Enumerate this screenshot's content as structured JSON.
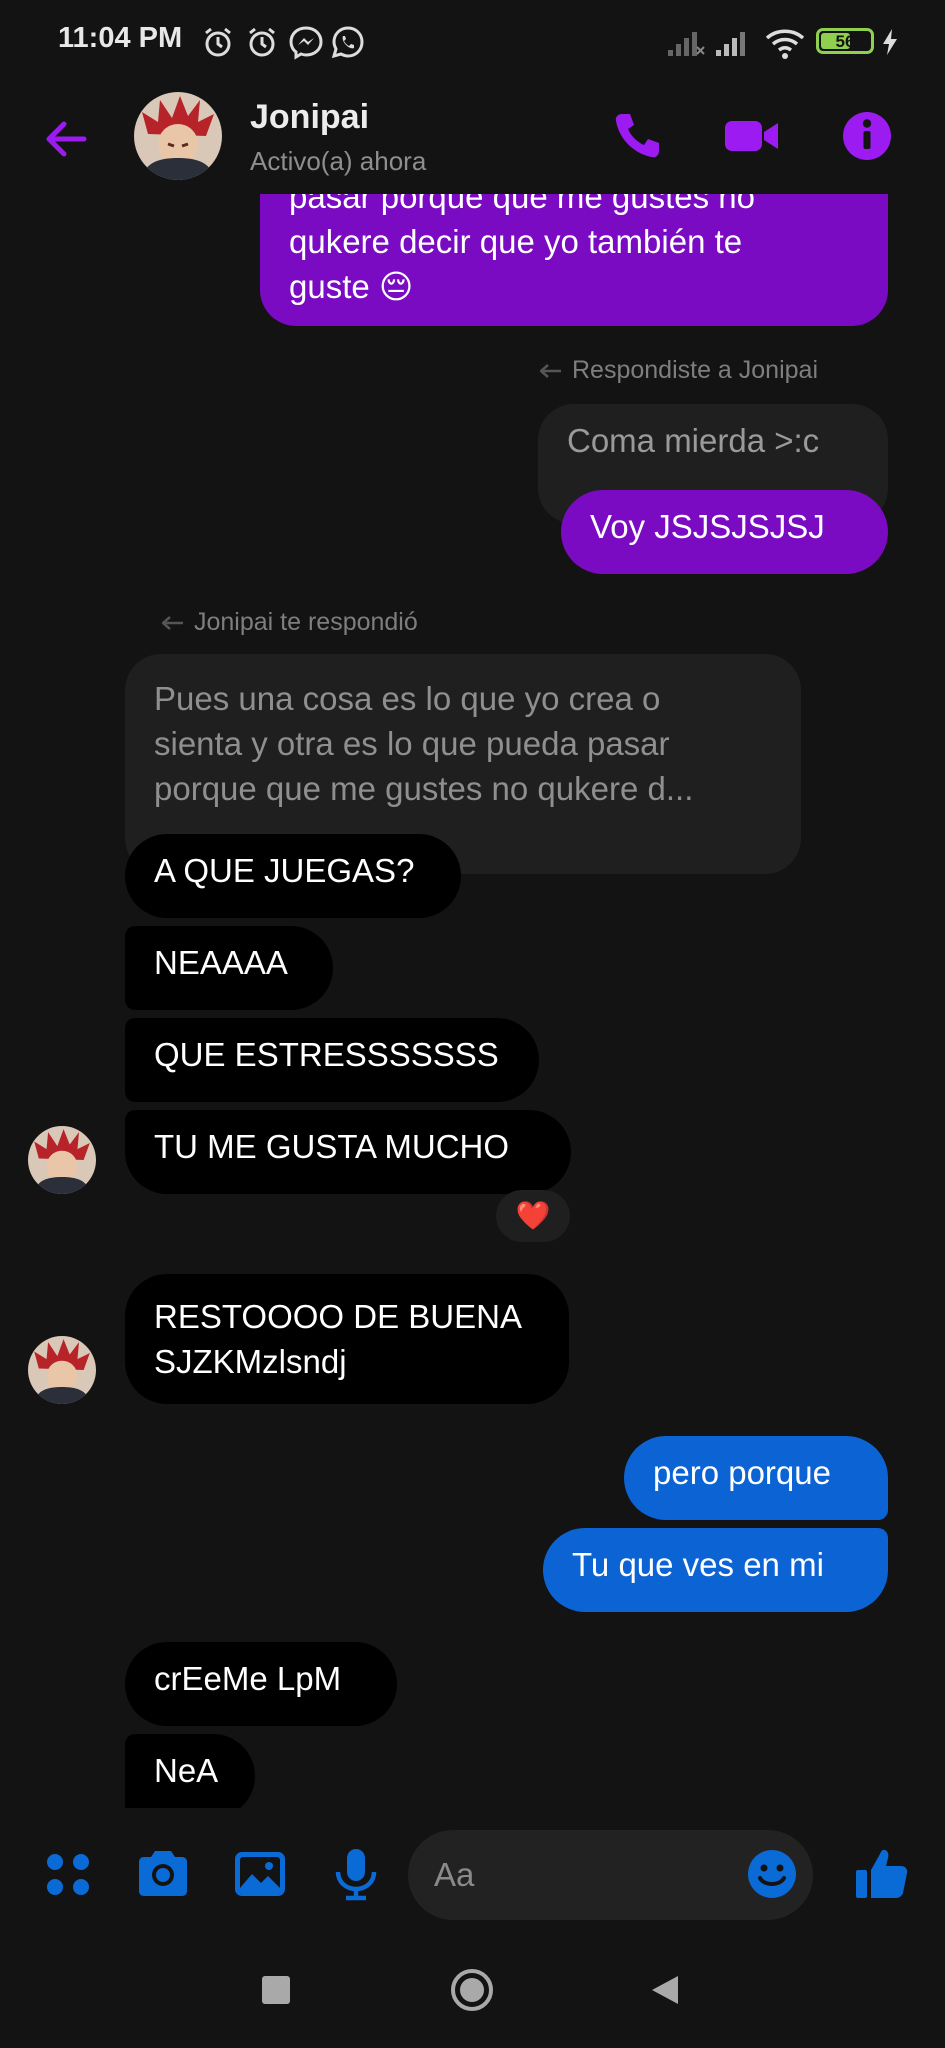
{
  "status_bar": {
    "time": "11:04 PM",
    "battery_level": "56",
    "icons": [
      "alarm-icon",
      "alarm-icon",
      "messenger-icon",
      "whatsapp-icon",
      "signal-icon",
      "signal-icon",
      "wifi-icon",
      "battery-icon",
      "charging-icon"
    ]
  },
  "header": {
    "contact_name": "Jonipai",
    "status": "Activo(a) ahora",
    "icons": [
      "back-arrow-icon",
      "phone-icon",
      "video-call-icon",
      "info-icon"
    ]
  },
  "colors": {
    "accent_purple": "#7a0bc2",
    "accent_blue": "#0c63d4",
    "background": "#131313",
    "incoming_bubble": "#000000"
  },
  "conversation": {
    "cut_off_message": {
      "line1": "pasar porque que me gustes no",
      "line2": "qukere decir que yo también te",
      "line3": "guste 😔"
    },
    "reply_note_1": "Respondiste a Jonipai",
    "quoted_1": "Coma mierda >:c",
    "reply_1": "Voy JSJSJSJSJ",
    "reply_note_2": "Jonipai te respondió",
    "quoted_2": {
      "line1": "Pues una cosa es lo que yo crea o",
      "line2": "sienta y otra es lo que pueda pasar",
      "line3": "porque que me gustes no qukere d..."
    },
    "incoming": {
      "m1": "A QUE JUEGAS?",
      "m2": "NEAAAA",
      "m3": "QUE ESTRESSSSSSS",
      "m4": "TU ME GUSTA MUCHO",
      "m4_reaction": "❤️",
      "m5_line1": "RESTOOOO DE BUENA",
      "m5_line2": "SJZKMzlsndj",
      "m6": "crEeMe LpM",
      "m7": "NeA"
    },
    "outgoing": {
      "m1": "pero porque",
      "m2": "Tu que ves en mi"
    }
  },
  "composer": {
    "placeholder": "Aa",
    "icons": [
      "menu-dots-icon",
      "camera-icon",
      "gallery-icon",
      "microphone-icon",
      "emoji-icon",
      "like-icon"
    ]
  },
  "navbar": {
    "icons": [
      "recent-apps-icon",
      "home-icon",
      "back-icon"
    ]
  }
}
